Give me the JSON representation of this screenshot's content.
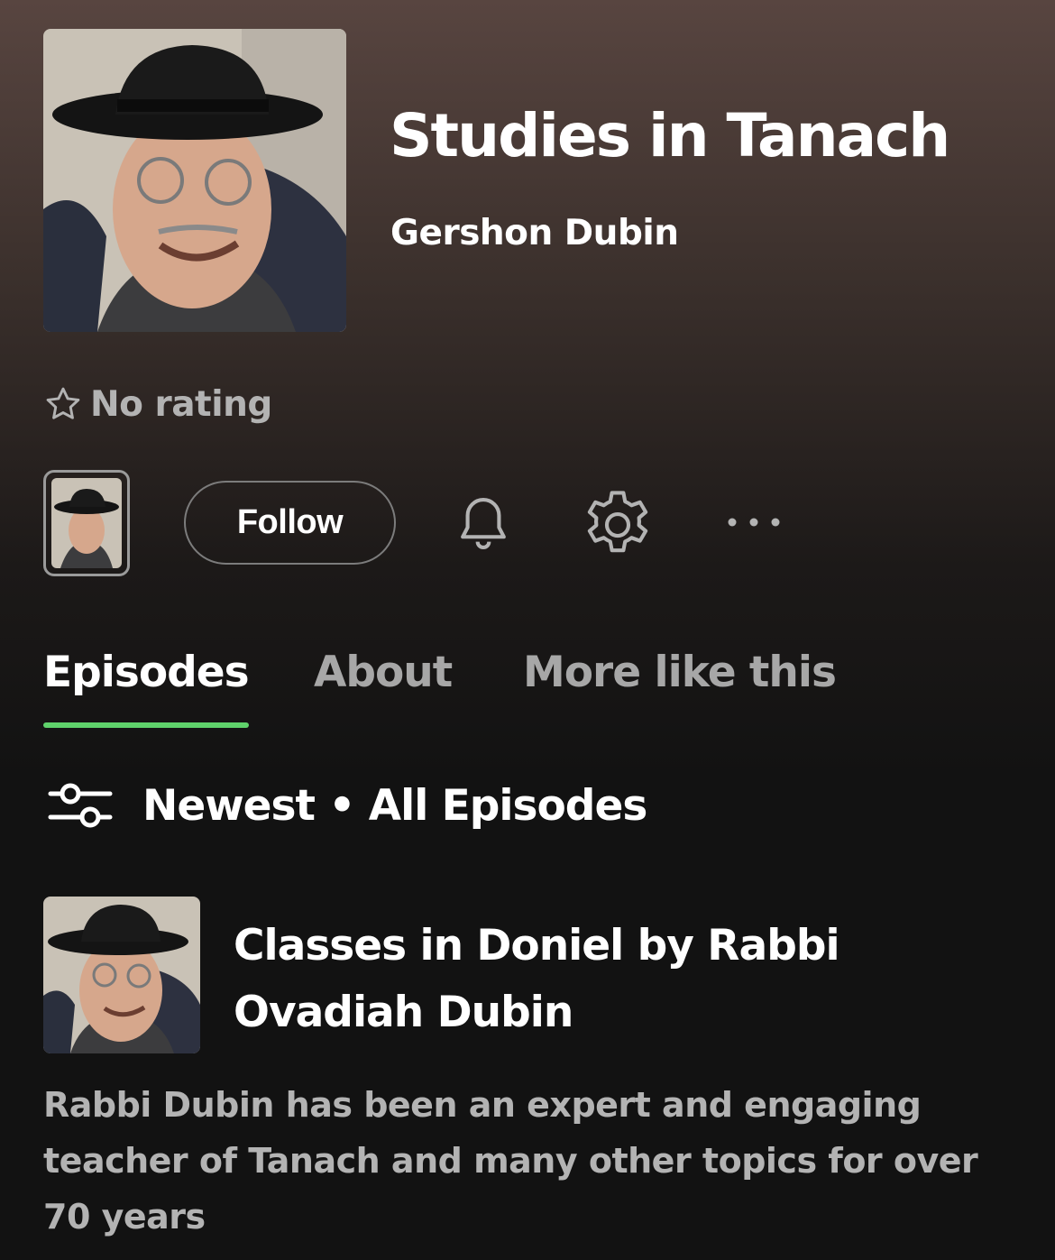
{
  "podcast": {
    "title": "Studies in Tanach",
    "author": "Gershon Dubin",
    "rating_text": "No rating"
  },
  "actions": {
    "follow_label": "Follow",
    "more_label": "•••"
  },
  "tabs": [
    {
      "label": "Episodes",
      "active": true
    },
    {
      "label": "About",
      "active": false
    },
    {
      "label": "More like this",
      "active": false
    }
  ],
  "filter": {
    "label": "Newest • All Episodes"
  },
  "episode": {
    "title": "Classes in Doniel by Rabbi Ovadiah Dubin",
    "description": "Rabbi Dubin has been an expert and engaging teacher of Tanach and many other topics for over 70 years"
  },
  "colors": {
    "accent": "#5fd26b",
    "background": "#121212",
    "muted_text": "#b3b3b3"
  },
  "icons": [
    "star-outline-icon",
    "bell-icon",
    "gear-icon",
    "more-dots-icon",
    "filter-sliders-icon"
  ]
}
